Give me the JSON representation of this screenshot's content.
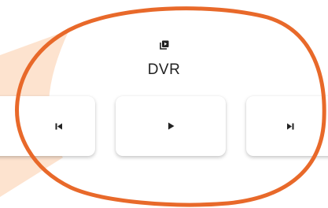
{
  "section": {
    "title": "DVR",
    "icon": "dvr-playlist-icon"
  },
  "controls": [
    {
      "name": "previous",
      "icon": "skip-previous-icon"
    },
    {
      "name": "play",
      "icon": "play-icon"
    },
    {
      "name": "next",
      "icon": "skip-next-icon"
    }
  ],
  "colors": {
    "highlight_ring": "#e8692a",
    "callout_fill": "#fde3cf",
    "card_bg": "#ffffff",
    "icon": "#222222"
  }
}
